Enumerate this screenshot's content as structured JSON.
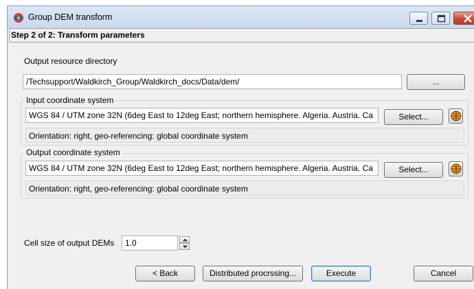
{
  "window": {
    "title": "Group DEM transform",
    "minimize_icon": "minimize-icon",
    "maximize_icon": "maximize-icon",
    "close_icon": "close-icon"
  },
  "step_header": "Step 2 of 2: Transform parameters",
  "output_dir": {
    "label": "Output resource directory",
    "value": "/Techsupport/Waldkirch_Group/Waldkirch_docs/Data/dem/",
    "browse_label": "..."
  },
  "input_cs": {
    "group_label": "Input coordinate system",
    "value": "WGS 84 / UTM zone 32N (6deg East to 12deg East; northern hemisphere. Algeria. Austria. Ca",
    "select_label": "Select...",
    "orientation": "Orientation: right, geo-referencing: global coordinate system"
  },
  "output_cs": {
    "group_label": "Output coordinate system",
    "value": "WGS 84 / UTM zone 32N (6deg East to 12deg East; northern hemisphere. Algeria. Austria. Ca",
    "select_label": "Select...",
    "orientation": "Orientation: right, geo-referencing: global coordinate system"
  },
  "cell_size": {
    "label": "Cell size of output DEMs",
    "value": "1.0"
  },
  "footer": {
    "back_label": "< Back",
    "distributed_label": "Distributed procrssing...",
    "execute_label": "Execute",
    "cancel_label": "Cancel"
  }
}
